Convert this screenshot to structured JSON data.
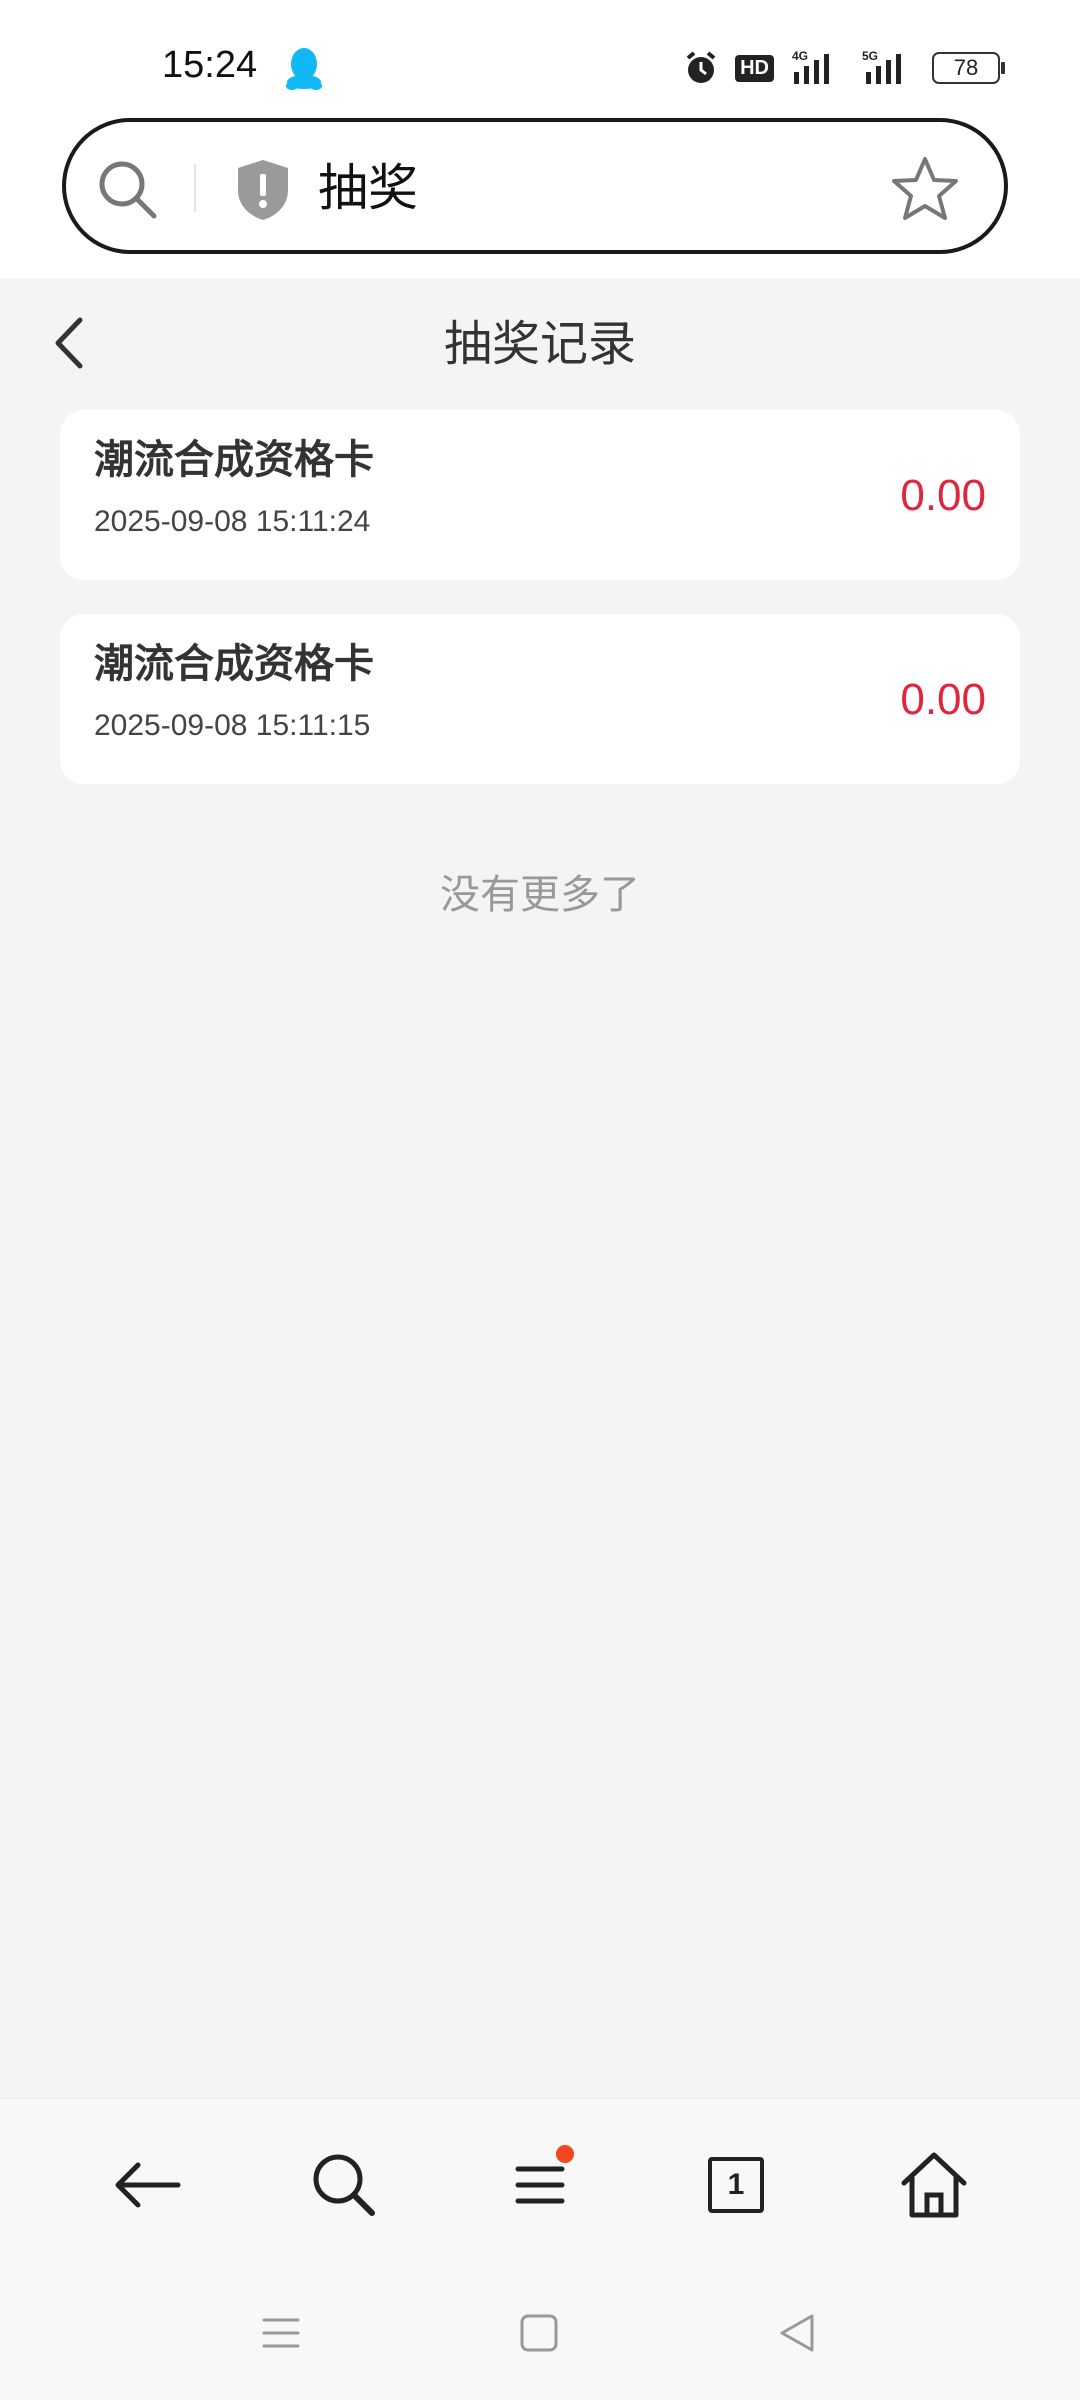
{
  "status_bar": {
    "time": "15:24",
    "hd_label": "HD",
    "net1": "4G",
    "net2": "5G",
    "battery": "78"
  },
  "address_bar": {
    "query": "抽奖"
  },
  "page": {
    "title": "抽奖记录"
  },
  "records": [
    {
      "name": "潮流合成资格卡",
      "time": "2025-09-08 15:11:24",
      "value": "0.00"
    },
    {
      "name": "潮流合成资格卡",
      "time": "2025-09-08 15:11:15",
      "value": "0.00"
    }
  ],
  "footer": {
    "no_more": "没有更多了"
  },
  "toolbar": {
    "tab_count": "1"
  },
  "colors": {
    "accent_red": "#e0263f",
    "qq_blue": "#12b7f5",
    "badge_red": "#f2471f"
  },
  "icons": [
    "qq-icon",
    "alarm-icon",
    "hd-icon",
    "signal-icon",
    "battery-icon",
    "search-icon",
    "shield-icon",
    "star-icon",
    "back-icon",
    "menu-icon",
    "tabs-icon",
    "home-icon"
  ]
}
